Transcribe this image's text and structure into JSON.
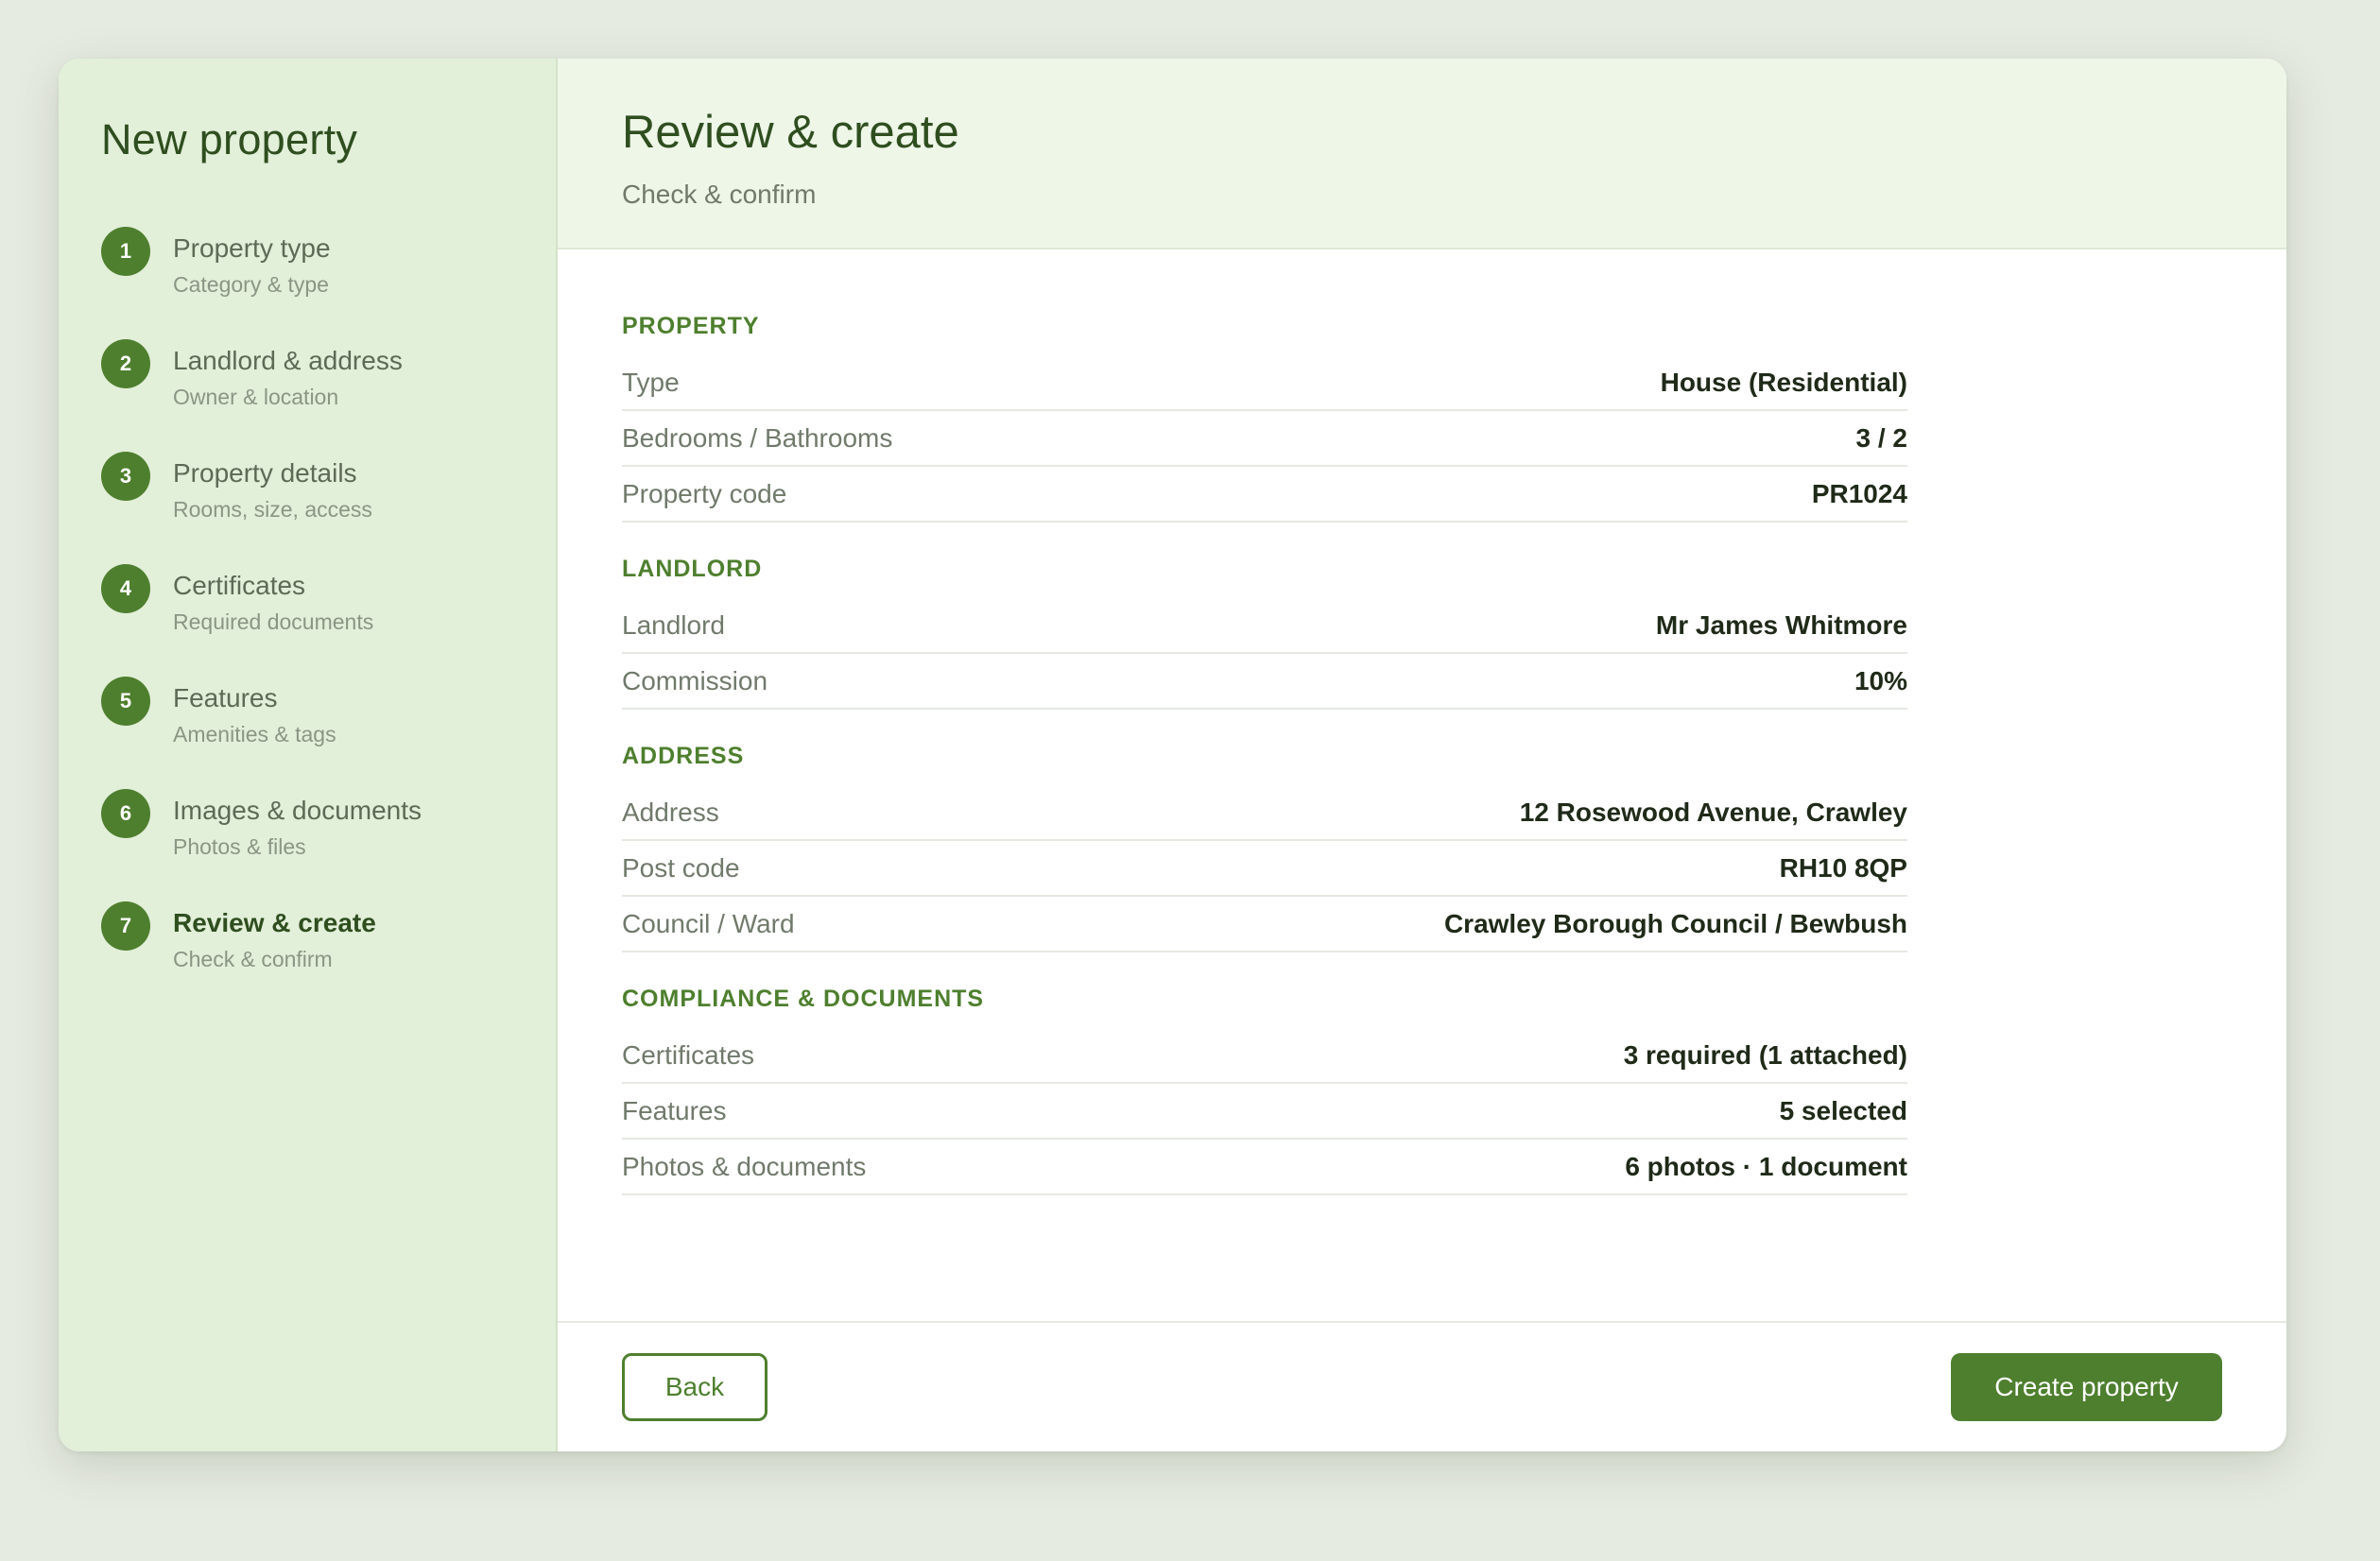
{
  "sidebar": {
    "title": "New property",
    "steps": [
      {
        "num": "1",
        "label": "Property type",
        "sub": "Category & type"
      },
      {
        "num": "2",
        "label": "Landlord & address",
        "sub": "Owner & location"
      },
      {
        "num": "3",
        "label": "Property details",
        "sub": "Rooms, size, access"
      },
      {
        "num": "4",
        "label": "Certificates",
        "sub": "Required documents"
      },
      {
        "num": "5",
        "label": "Features",
        "sub": "Amenities & tags"
      },
      {
        "num": "6",
        "label": "Images & documents",
        "sub": "Photos & files"
      },
      {
        "num": "7",
        "label": "Review & create",
        "sub": "Check & confirm"
      }
    ],
    "active_step": 7
  },
  "header": {
    "title": "Review & create",
    "subtitle": "Check & confirm"
  },
  "sections": {
    "property": {
      "title": "PROPERTY",
      "rows": [
        {
          "label": "Type",
          "value": "House (Residential)"
        },
        {
          "label": "Bedrooms / Bathrooms",
          "value": "3 / 2"
        },
        {
          "label": "Property code",
          "value": "PR1024"
        }
      ]
    },
    "landlord": {
      "title": "LANDLORD",
      "rows": [
        {
          "label": "Landlord",
          "value": "Mr James Whitmore"
        },
        {
          "label": "Commission",
          "value": "10%"
        }
      ]
    },
    "address": {
      "title": "ADDRESS",
      "rows": [
        {
          "label": "Address",
          "value": "12 Rosewood Avenue, Crawley"
        },
        {
          "label": "Post code",
          "value": "RH10 8QP"
        },
        {
          "label": "Council / Ward",
          "value": "Crawley Borough Council / Bewbush"
        }
      ]
    },
    "compliance": {
      "title": "COMPLIANCE & DOCUMENTS",
      "rows": [
        {
          "label": "Certificates",
          "value": "3 required (1 attached)"
        },
        {
          "label": "Features",
          "value": "5 selected"
        },
        {
          "label": "Photos & documents",
          "value": "6 photos · 1 document"
        }
      ]
    }
  },
  "footer": {
    "back_label": "Back",
    "create_label": "Create property"
  },
  "colors": {
    "accent": "#4e7f2e",
    "sidebar_bg": "#e2efd9",
    "header_bg": "#eef6e8",
    "page_bg": "#e6ebe1"
  }
}
